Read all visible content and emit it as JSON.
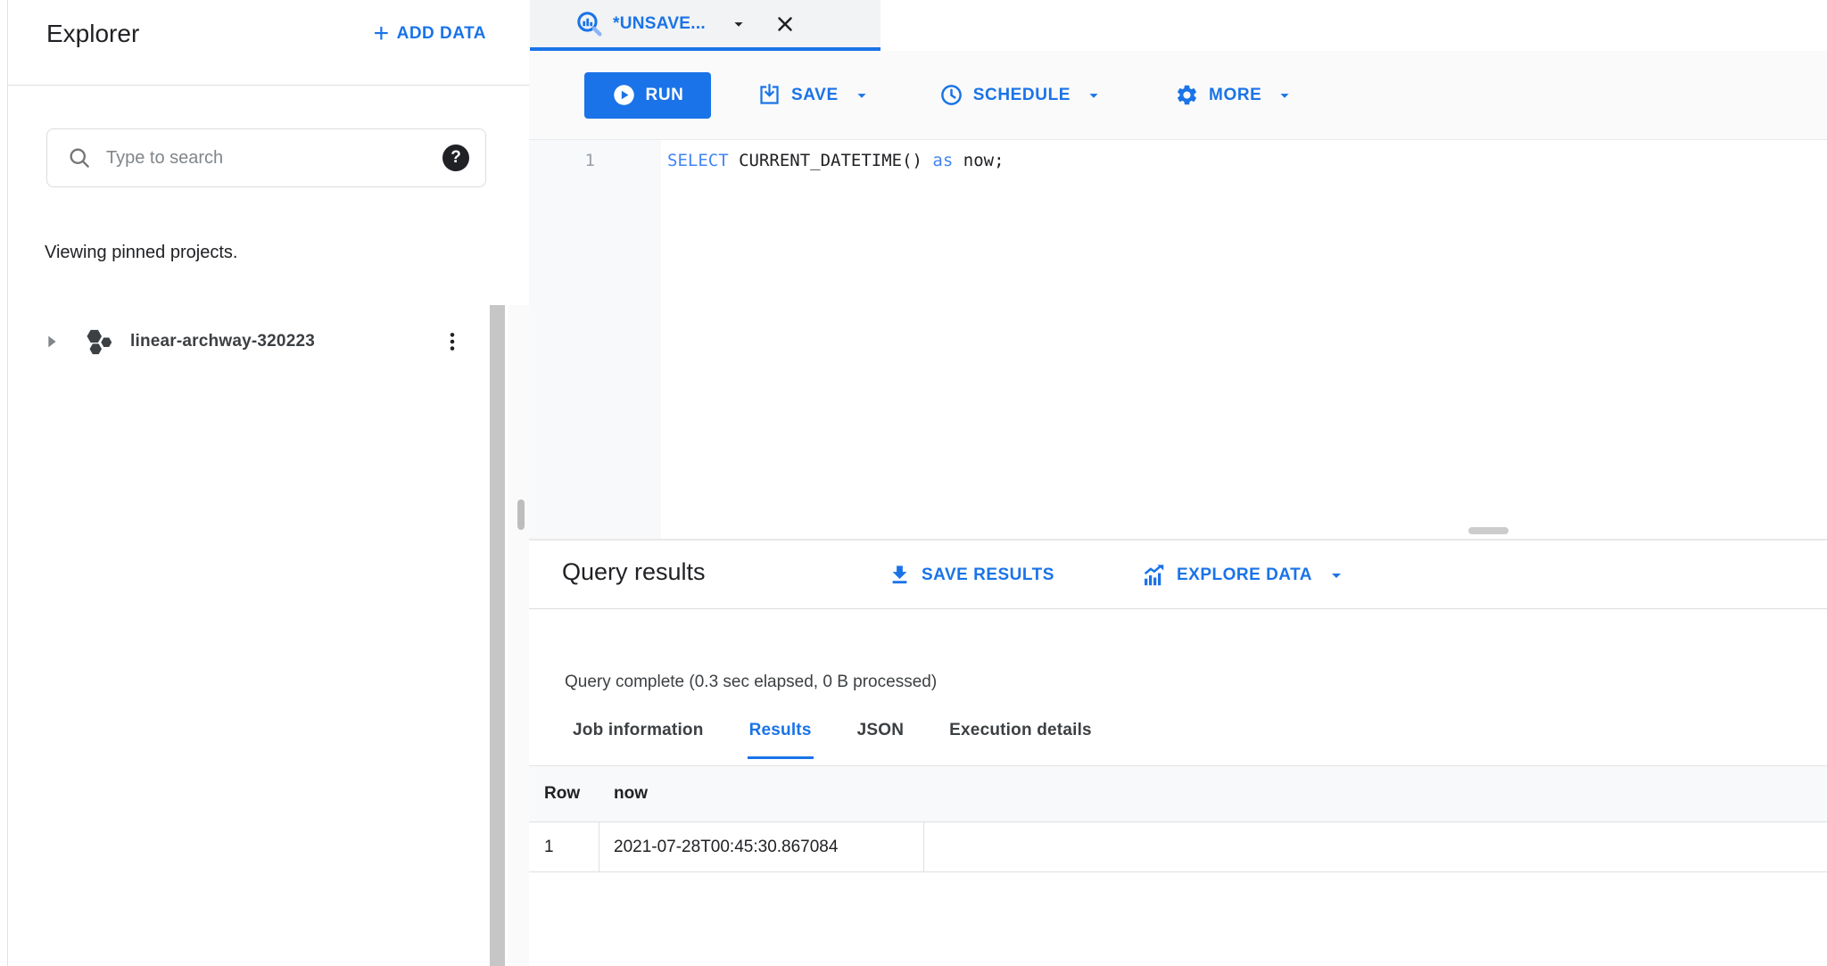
{
  "sidebar": {
    "title": "Explorer",
    "add_data_label": "ADD DATA",
    "search_placeholder": "Type to search",
    "viewing_note": "Viewing pinned projects.",
    "project_name": "linear-archway-320223"
  },
  "editor": {
    "tab_label": "*UNSAVE...",
    "toolbar": {
      "run_label": "RUN",
      "save_label": "SAVE",
      "schedule_label": "SCHEDULE",
      "more_label": "MORE"
    },
    "line_number": "1",
    "code_parts": [
      {
        "t": "SELECT",
        "kind": "keyword"
      },
      {
        "t": " CURRENT_DATETIME() ",
        "kind": "plain"
      },
      {
        "t": "as",
        "kind": "keyword"
      },
      {
        "t": " now;",
        "kind": "plain"
      }
    ]
  },
  "results": {
    "title": "Query results",
    "save_results_label": "SAVE RESULTS",
    "explore_data_label": "EXPLORE DATA",
    "status": "Query complete (0.3 sec elapsed, 0 B processed)",
    "tabs": [
      "Job information",
      "Results",
      "JSON",
      "Execution details"
    ],
    "active_tab": "Results",
    "table": {
      "columns": [
        "Row",
        "now"
      ],
      "rows": [
        [
          "1",
          "2021-07-28T00:45:30.867084"
        ]
      ]
    }
  },
  "colors": {
    "accent": "#1a73e8",
    "sql_keyword": "#4285f4",
    "text_primary": "#202124",
    "text_secondary": "#3c4043",
    "tab_background": "#f1f3f4",
    "toolbar_background": "#fafafa",
    "gutter_background": "#f8f9fa",
    "table_header_background": "#f8f9fa",
    "border": "#e0e0e0"
  },
  "icons": {
    "tab": "query-magnifier-chart-icon",
    "run": "play-icon",
    "save": "save-icon",
    "schedule": "clock-icon",
    "more": "gear-icon",
    "save_results": "download-icon",
    "explore_data": "chart-icon"
  }
}
